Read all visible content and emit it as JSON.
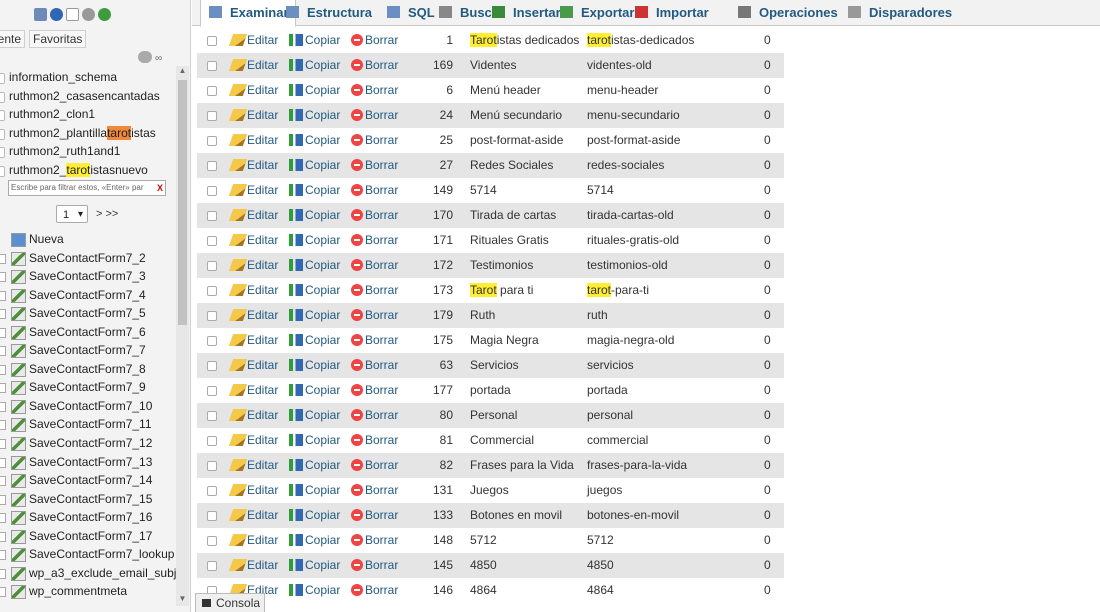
{
  "sidebar": {
    "tabs": {
      "recent": "iente",
      "favorites": "Favoritas"
    },
    "databases": [
      {
        "parts": [
          {
            "t": "information_schema"
          }
        ]
      },
      {
        "parts": [
          {
            "t": "ruthmon2_casasencantadas"
          }
        ]
      },
      {
        "parts": [
          {
            "t": "ruthmon2_clon1"
          }
        ]
      },
      {
        "parts": [
          {
            "t": "ruthmon2_plantilla"
          },
          {
            "t": "tarot",
            "hl": "orange"
          },
          {
            "t": "istas"
          }
        ]
      },
      {
        "parts": [
          {
            "t": "ruthmon2_ruth1and1"
          }
        ]
      },
      {
        "parts": [
          {
            "t": "ruthmon2_"
          },
          {
            "t": "tarot",
            "hl": "yellow"
          },
          {
            "t": "istasnuevo"
          }
        ]
      }
    ],
    "filter_placeholder": "Escribe para filtrar estos, «Enter» par",
    "filter_clear": "X",
    "page": "1",
    "pager_next": "> >>",
    "new_label": "Nueva",
    "tables": [
      "SaveContactForm7_2",
      "SaveContactForm7_3",
      "SaveContactForm7_4",
      "SaveContactForm7_5",
      "SaveContactForm7_6",
      "SaveContactForm7_7",
      "SaveContactForm7_8",
      "SaveContactForm7_9",
      "SaveContactForm7_10",
      "SaveContactForm7_11",
      "SaveContactForm7_12",
      "SaveContactForm7_13",
      "SaveContactForm7_14",
      "SaveContactForm7_15",
      "SaveContactForm7_16",
      "SaveContactForm7_17",
      "SaveContactForm7_lookup",
      "wp_a3_exclude_email_subj",
      "wp_commentmeta"
    ]
  },
  "tabs": [
    {
      "label": "Examinar",
      "icon": "browse-icon",
      "active": true
    },
    {
      "label": "Estructura",
      "icon": "structure-icon"
    },
    {
      "label": "SQL",
      "icon": "sql-icon"
    },
    {
      "label": "Buscar",
      "icon": "search-icon"
    },
    {
      "label": "Insertar",
      "icon": "insert-icon"
    },
    {
      "label": "Exportar",
      "icon": "export-icon"
    },
    {
      "label": "Importar",
      "icon": "import-icon"
    },
    {
      "label": "Operaciones",
      "icon": "wrench-icon"
    },
    {
      "label": "Disparadores",
      "icon": "triggers-icon"
    }
  ],
  "row_actions": {
    "edit": "Editar",
    "copy": "Copiar",
    "delete": "Borrar"
  },
  "rows": [
    {
      "id": "1",
      "title": [
        {
          "t": "Tarot",
          "hl": true
        },
        {
          "t": "istas dedicados"
        }
      ],
      "slug": [
        {
          "t": "tarot",
          "hl": true
        },
        {
          "t": "istas-dedicados"
        }
      ],
      "count": "0"
    },
    {
      "id": "169",
      "title": [
        {
          "t": "Videntes"
        }
      ],
      "slug": [
        {
          "t": "videntes-old"
        }
      ],
      "count": "0"
    },
    {
      "id": "6",
      "title": [
        {
          "t": "Menú header"
        }
      ],
      "slug": [
        {
          "t": "menu-header"
        }
      ],
      "count": "0"
    },
    {
      "id": "24",
      "title": [
        {
          "t": "Menú secundario"
        }
      ],
      "slug": [
        {
          "t": "menu-secundario"
        }
      ],
      "count": "0"
    },
    {
      "id": "25",
      "title": [
        {
          "t": "post-format-aside"
        }
      ],
      "slug": [
        {
          "t": "post-format-aside"
        }
      ],
      "count": "0"
    },
    {
      "id": "27",
      "title": [
        {
          "t": "Redes Sociales"
        }
      ],
      "slug": [
        {
          "t": "redes-sociales"
        }
      ],
      "count": "0"
    },
    {
      "id": "149",
      "title": [
        {
          "t": "5714"
        }
      ],
      "slug": [
        {
          "t": "5714"
        }
      ],
      "count": "0"
    },
    {
      "id": "170",
      "title": [
        {
          "t": "Tirada de cartas"
        }
      ],
      "slug": [
        {
          "t": "tirada-cartas-old"
        }
      ],
      "count": "0"
    },
    {
      "id": "171",
      "title": [
        {
          "t": "Rituales Gratis"
        }
      ],
      "slug": [
        {
          "t": "rituales-gratis-old"
        }
      ],
      "count": "0"
    },
    {
      "id": "172",
      "title": [
        {
          "t": "Testimonios"
        }
      ],
      "slug": [
        {
          "t": "testimonios-old"
        }
      ],
      "count": "0"
    },
    {
      "id": "173",
      "title": [
        {
          "t": "Tarot",
          "hl": true
        },
        {
          "t": " para ti"
        }
      ],
      "slug": [
        {
          "t": "tarot",
          "hl": true
        },
        {
          "t": "-para-ti"
        }
      ],
      "count": "0"
    },
    {
      "id": "179",
      "title": [
        {
          "t": "Ruth"
        }
      ],
      "slug": [
        {
          "t": "ruth"
        }
      ],
      "count": "0"
    },
    {
      "id": "175",
      "title": [
        {
          "t": "Magia Negra"
        }
      ],
      "slug": [
        {
          "t": "magia-negra-old"
        }
      ],
      "count": "0"
    },
    {
      "id": "63",
      "title": [
        {
          "t": "Servicios"
        }
      ],
      "slug": [
        {
          "t": "servicios"
        }
      ],
      "count": "0"
    },
    {
      "id": "177",
      "title": [
        {
          "t": "portada"
        }
      ],
      "slug": [
        {
          "t": "portada"
        }
      ],
      "count": "0"
    },
    {
      "id": "80",
      "title": [
        {
          "t": "Personal"
        }
      ],
      "slug": [
        {
          "t": "personal"
        }
      ],
      "count": "0"
    },
    {
      "id": "81",
      "title": [
        {
          "t": "Commercial"
        }
      ],
      "slug": [
        {
          "t": "commercial"
        }
      ],
      "count": "0"
    },
    {
      "id": "82",
      "title": [
        {
          "t": "Frases para la Vida"
        }
      ],
      "slug": [
        {
          "t": "frases-para-la-vida"
        }
      ],
      "count": "0"
    },
    {
      "id": "131",
      "title": [
        {
          "t": "Juegos"
        }
      ],
      "slug": [
        {
          "t": "juegos"
        }
      ],
      "count": "0"
    },
    {
      "id": "133",
      "title": [
        {
          "t": "Botones en movil"
        }
      ],
      "slug": [
        {
          "t": "botones-en-movil"
        }
      ],
      "count": "0"
    },
    {
      "id": "148",
      "title": [
        {
          "t": "5712"
        }
      ],
      "slug": [
        {
          "t": "5712"
        }
      ],
      "count": "0"
    },
    {
      "id": "145",
      "title": [
        {
          "t": "4850"
        }
      ],
      "slug": [
        {
          "t": "4850"
        }
      ],
      "count": "0"
    },
    {
      "id": "146",
      "title": [
        {
          "t": "4864"
        }
      ],
      "slug": [
        {
          "t": "4864"
        }
      ],
      "count": "0"
    }
  ],
  "console_label": "Consola",
  "colors": {
    "link": "#235a81",
    "highlight": "#ffee33",
    "highlight_orange": "#f0873b",
    "row_alt": "#e5e5e5"
  }
}
